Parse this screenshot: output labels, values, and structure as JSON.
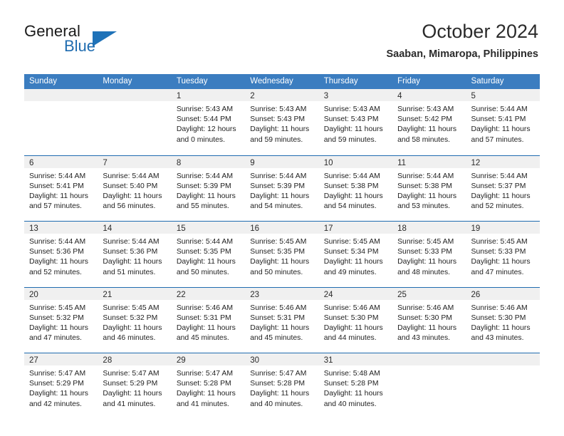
{
  "brand": {
    "name_part1": "General",
    "name_part2": "Blue",
    "flag_icon": "blue-triangle-flag-icon"
  },
  "header": {
    "title": "October 2024",
    "subtitle": "Saaban, Mimaropa, Philippines"
  },
  "colors": {
    "header_blue": "#3b7dc0",
    "row_divider_blue": "#1f6cb0",
    "brand_blue": "#1f6cb0",
    "day_band_gray": "#f0f0f0",
    "text": "#222222"
  },
  "weekdays": [
    "Sunday",
    "Monday",
    "Tuesday",
    "Wednesday",
    "Thursday",
    "Friday",
    "Saturday"
  ],
  "weeks": [
    [
      {
        "empty": true
      },
      {
        "empty": true
      },
      {
        "day": "1",
        "sunrise": "Sunrise: 5:43 AM",
        "sunset": "Sunset: 5:44 PM",
        "daylight1": "Daylight: 12 hours",
        "daylight2": "and 0 minutes."
      },
      {
        "day": "2",
        "sunrise": "Sunrise: 5:43 AM",
        "sunset": "Sunset: 5:43 PM",
        "daylight1": "Daylight: 11 hours",
        "daylight2": "and 59 minutes."
      },
      {
        "day": "3",
        "sunrise": "Sunrise: 5:43 AM",
        "sunset": "Sunset: 5:43 PM",
        "daylight1": "Daylight: 11 hours",
        "daylight2": "and 59 minutes."
      },
      {
        "day": "4",
        "sunrise": "Sunrise: 5:43 AM",
        "sunset": "Sunset: 5:42 PM",
        "daylight1": "Daylight: 11 hours",
        "daylight2": "and 58 minutes."
      },
      {
        "day": "5",
        "sunrise": "Sunrise: 5:44 AM",
        "sunset": "Sunset: 5:41 PM",
        "daylight1": "Daylight: 11 hours",
        "daylight2": "and 57 minutes."
      }
    ],
    [
      {
        "day": "6",
        "sunrise": "Sunrise: 5:44 AM",
        "sunset": "Sunset: 5:41 PM",
        "daylight1": "Daylight: 11 hours",
        "daylight2": "and 57 minutes."
      },
      {
        "day": "7",
        "sunrise": "Sunrise: 5:44 AM",
        "sunset": "Sunset: 5:40 PM",
        "daylight1": "Daylight: 11 hours",
        "daylight2": "and 56 minutes."
      },
      {
        "day": "8",
        "sunrise": "Sunrise: 5:44 AM",
        "sunset": "Sunset: 5:39 PM",
        "daylight1": "Daylight: 11 hours",
        "daylight2": "and 55 minutes."
      },
      {
        "day": "9",
        "sunrise": "Sunrise: 5:44 AM",
        "sunset": "Sunset: 5:39 PM",
        "daylight1": "Daylight: 11 hours",
        "daylight2": "and 54 minutes."
      },
      {
        "day": "10",
        "sunrise": "Sunrise: 5:44 AM",
        "sunset": "Sunset: 5:38 PM",
        "daylight1": "Daylight: 11 hours",
        "daylight2": "and 54 minutes."
      },
      {
        "day": "11",
        "sunrise": "Sunrise: 5:44 AM",
        "sunset": "Sunset: 5:38 PM",
        "daylight1": "Daylight: 11 hours",
        "daylight2": "and 53 minutes."
      },
      {
        "day": "12",
        "sunrise": "Sunrise: 5:44 AM",
        "sunset": "Sunset: 5:37 PM",
        "daylight1": "Daylight: 11 hours",
        "daylight2": "and 52 minutes."
      }
    ],
    [
      {
        "day": "13",
        "sunrise": "Sunrise: 5:44 AM",
        "sunset": "Sunset: 5:36 PM",
        "daylight1": "Daylight: 11 hours",
        "daylight2": "and 52 minutes."
      },
      {
        "day": "14",
        "sunrise": "Sunrise: 5:44 AM",
        "sunset": "Sunset: 5:36 PM",
        "daylight1": "Daylight: 11 hours",
        "daylight2": "and 51 minutes."
      },
      {
        "day": "15",
        "sunrise": "Sunrise: 5:44 AM",
        "sunset": "Sunset: 5:35 PM",
        "daylight1": "Daylight: 11 hours",
        "daylight2": "and 50 minutes."
      },
      {
        "day": "16",
        "sunrise": "Sunrise: 5:45 AM",
        "sunset": "Sunset: 5:35 PM",
        "daylight1": "Daylight: 11 hours",
        "daylight2": "and 50 minutes."
      },
      {
        "day": "17",
        "sunrise": "Sunrise: 5:45 AM",
        "sunset": "Sunset: 5:34 PM",
        "daylight1": "Daylight: 11 hours",
        "daylight2": "and 49 minutes."
      },
      {
        "day": "18",
        "sunrise": "Sunrise: 5:45 AM",
        "sunset": "Sunset: 5:33 PM",
        "daylight1": "Daylight: 11 hours",
        "daylight2": "and 48 minutes."
      },
      {
        "day": "19",
        "sunrise": "Sunrise: 5:45 AM",
        "sunset": "Sunset: 5:33 PM",
        "daylight1": "Daylight: 11 hours",
        "daylight2": "and 47 minutes."
      }
    ],
    [
      {
        "day": "20",
        "sunrise": "Sunrise: 5:45 AM",
        "sunset": "Sunset: 5:32 PM",
        "daylight1": "Daylight: 11 hours",
        "daylight2": "and 47 minutes."
      },
      {
        "day": "21",
        "sunrise": "Sunrise: 5:45 AM",
        "sunset": "Sunset: 5:32 PM",
        "daylight1": "Daylight: 11 hours",
        "daylight2": "and 46 minutes."
      },
      {
        "day": "22",
        "sunrise": "Sunrise: 5:46 AM",
        "sunset": "Sunset: 5:31 PM",
        "daylight1": "Daylight: 11 hours",
        "daylight2": "and 45 minutes."
      },
      {
        "day": "23",
        "sunrise": "Sunrise: 5:46 AM",
        "sunset": "Sunset: 5:31 PM",
        "daylight1": "Daylight: 11 hours",
        "daylight2": "and 45 minutes."
      },
      {
        "day": "24",
        "sunrise": "Sunrise: 5:46 AM",
        "sunset": "Sunset: 5:30 PM",
        "daylight1": "Daylight: 11 hours",
        "daylight2": "and 44 minutes."
      },
      {
        "day": "25",
        "sunrise": "Sunrise: 5:46 AM",
        "sunset": "Sunset: 5:30 PM",
        "daylight1": "Daylight: 11 hours",
        "daylight2": "and 43 minutes."
      },
      {
        "day": "26",
        "sunrise": "Sunrise: 5:46 AM",
        "sunset": "Sunset: 5:30 PM",
        "daylight1": "Daylight: 11 hours",
        "daylight2": "and 43 minutes."
      }
    ],
    [
      {
        "day": "27",
        "sunrise": "Sunrise: 5:47 AM",
        "sunset": "Sunset: 5:29 PM",
        "daylight1": "Daylight: 11 hours",
        "daylight2": "and 42 minutes."
      },
      {
        "day": "28",
        "sunrise": "Sunrise: 5:47 AM",
        "sunset": "Sunset: 5:29 PM",
        "daylight1": "Daylight: 11 hours",
        "daylight2": "and 41 minutes."
      },
      {
        "day": "29",
        "sunrise": "Sunrise: 5:47 AM",
        "sunset": "Sunset: 5:28 PM",
        "daylight1": "Daylight: 11 hours",
        "daylight2": "and 41 minutes."
      },
      {
        "day": "30",
        "sunrise": "Sunrise: 5:47 AM",
        "sunset": "Sunset: 5:28 PM",
        "daylight1": "Daylight: 11 hours",
        "daylight2": "and 40 minutes."
      },
      {
        "day": "31",
        "sunrise": "Sunrise: 5:48 AM",
        "sunset": "Sunset: 5:28 PM",
        "daylight1": "Daylight: 11 hours",
        "daylight2": "and 40 minutes."
      },
      {
        "empty": true
      },
      {
        "empty": true
      }
    ]
  ]
}
